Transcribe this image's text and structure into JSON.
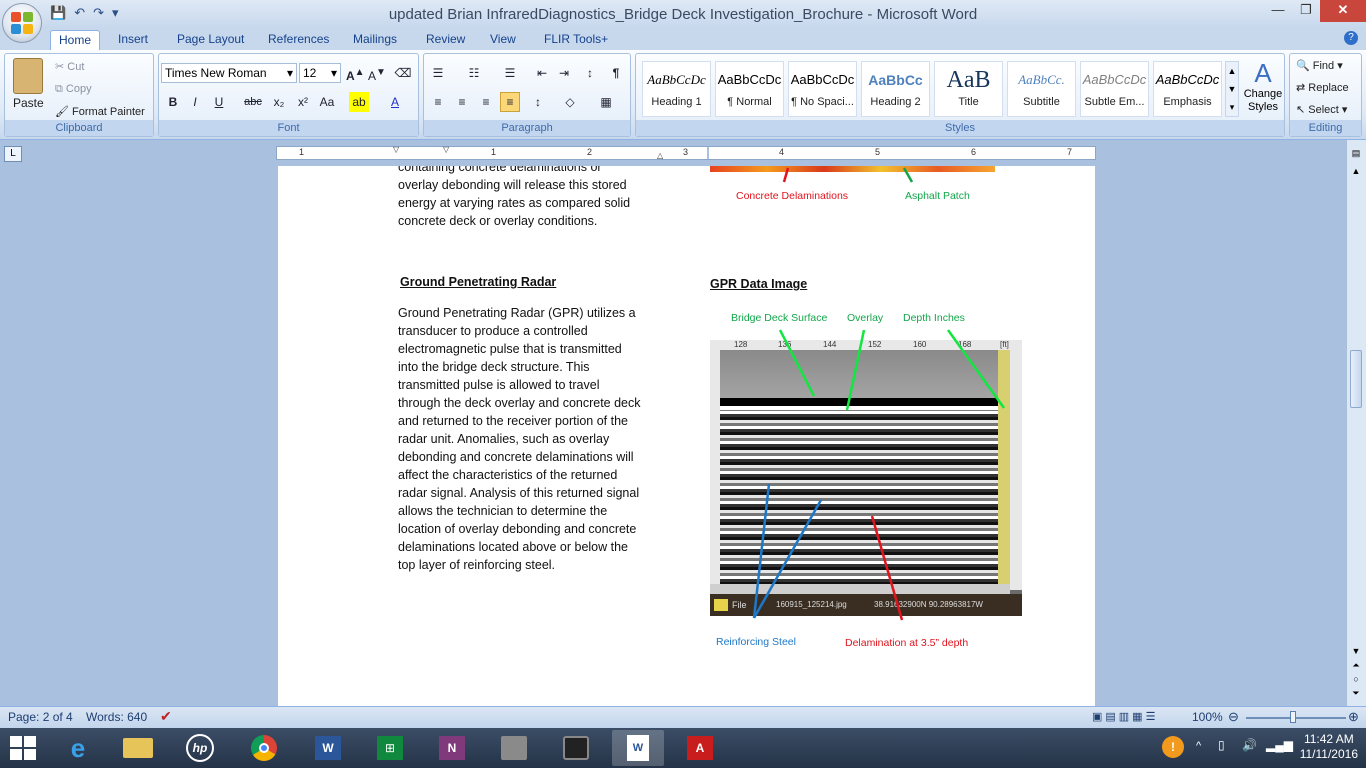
{
  "window": {
    "title": "updated Brian InfraredDiagnostics_Bridge Deck Investigation_Brochure - Microsoft Word"
  },
  "tabs": [
    "Home",
    "Insert",
    "Page Layout",
    "References",
    "Mailings",
    "Review",
    "View",
    "FLIR Tools+"
  ],
  "clipboard": {
    "paste": "Paste",
    "cut": "Cut",
    "copy": "Copy",
    "format_painter": "Format Painter",
    "label": "Clipboard"
  },
  "font": {
    "name": "Times New Roman",
    "size": "12",
    "label": "Font"
  },
  "paragraph": {
    "label": "Paragraph"
  },
  "styles": {
    "items": [
      {
        "preview": "AaBbCcDc",
        "name": "Heading 1"
      },
      {
        "preview": "AaBbCcDc",
        "name": "¶ Normal"
      },
      {
        "preview": "AaBbCcDc",
        "name": "¶ No Spaci..."
      },
      {
        "preview": "AaBbCc",
        "name": "Heading 2"
      },
      {
        "preview": "AaB",
        "name": "Title"
      },
      {
        "preview": "AaBbCc.",
        "name": "Subtitle"
      },
      {
        "preview": "AaBbCcDc",
        "name": "Subtle Em..."
      },
      {
        "preview": "AaBbCcDc",
        "name": "Emphasis"
      }
    ],
    "change": "Change Styles",
    "label": "Styles"
  },
  "editing": {
    "find": "Find",
    "replace": "Replace",
    "select": "Select",
    "label": "Editing"
  },
  "ruler_numbers": [
    "1",
    "1",
    "2",
    "3",
    "4",
    "5",
    "6",
    "7"
  ],
  "doc": {
    "top_text": [
      "containing concrete delaminations or",
      "overlay debonding will release this stored",
      "energy at varying rates as compared solid",
      "concrete deck or overlay conditions."
    ],
    "ir_labels": {
      "delam": "Concrete  Delaminations",
      "asphalt": "Asphalt Patch"
    },
    "gpr_heading": "Ground Penetrating Radar",
    "gpr_body": [
      "Ground Penetrating Radar (GPR) utilizes a",
      "transducer to produce a controlled",
      "electromagnetic pulse that is transmitted",
      "into the bridge deck structure.  This",
      "transmitted pulse is allowed to travel",
      "through the deck overlay and concrete deck",
      "and returned to the receiver portion of the",
      "radar unit.  Anomalies, such as overlay",
      "debonding and concrete delaminations will",
      "affect the characteristics of the returned",
      "radar signal.  Analysis of this returned signal",
      "allows the technician to  determine the",
      "location of overlay debonding and concrete",
      "delaminations located above or below the",
      "top layer of reinforcing steel."
    ],
    "gpr_image_heading": "GPR Data Image",
    "labels": {
      "surface": "Bridge Deck Surface",
      "overlay": "Overlay",
      "depth": "Depth  Inches",
      "steel": "Reinforcing Steel",
      "delam35": "Delamination at 3.5” depth"
    },
    "gpr_ticks": [
      "128",
      "136",
      "144",
      "152",
      "160",
      "168"
    ],
    "gpr_file": "File",
    "gpr_filename": "160915_125214.jpg",
    "gpr_coords": "38.91632900N   90.28963817W",
    "gpr_unit": "[ft]"
  },
  "status": {
    "page": "Page: 2 of 4",
    "words": "Words: 640",
    "zoom": "100%"
  },
  "clock": {
    "time": "11:42 AM",
    "date": "11/11/2016"
  },
  "colors": {
    "accent": "#15428b",
    "red_label": "#e0141e",
    "green_label": "#12a64a",
    "blue_label": "#1e78c8"
  }
}
